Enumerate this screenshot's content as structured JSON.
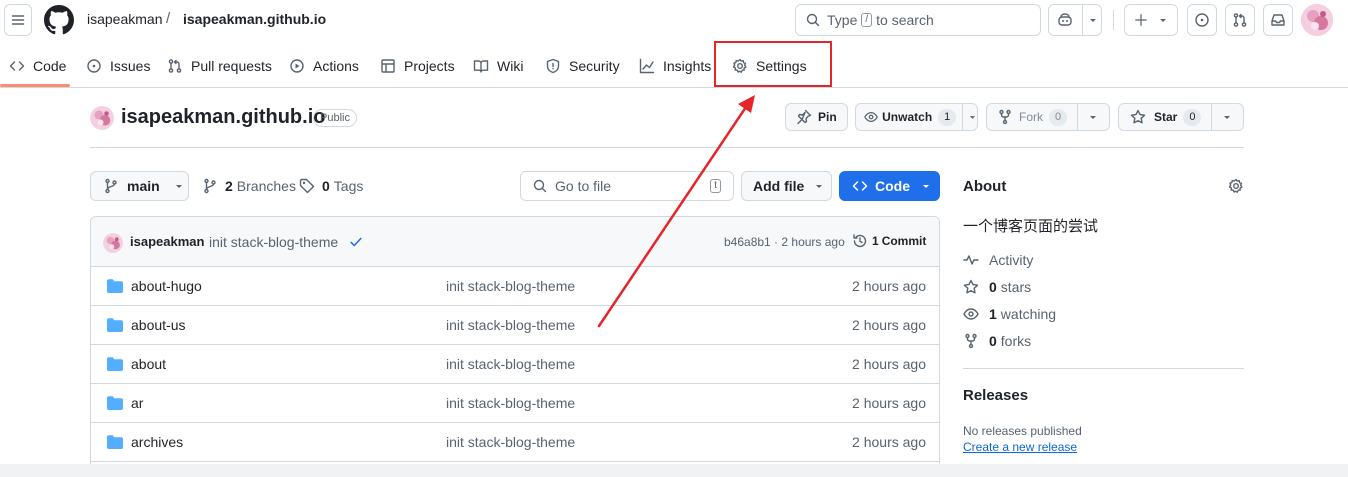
{
  "header": {
    "owner": "isapeakman",
    "separator": "/",
    "repo": "isapeakman.github.io",
    "search_prefix": "Type",
    "search_key": "/",
    "search_suffix": "to search"
  },
  "tabs": [
    {
      "label": "Code",
      "icon": "code-icon"
    },
    {
      "label": "Issues",
      "icon": "issue-icon"
    },
    {
      "label": "Pull requests",
      "icon": "pull-request-icon"
    },
    {
      "label": "Actions",
      "icon": "play-icon"
    },
    {
      "label": "Projects",
      "icon": "table-icon"
    },
    {
      "label": "Wiki",
      "icon": "book-icon"
    },
    {
      "label": "Security",
      "icon": "shield-icon"
    },
    {
      "label": "Insights",
      "icon": "graph-icon"
    },
    {
      "label": "Settings",
      "icon": "gear-icon"
    }
  ],
  "repo": {
    "title": "isapeakman.github.io",
    "visibility": "Public",
    "pin_label": "Pin",
    "watch_label": "Unwatch",
    "watch_count": "1",
    "fork_label": "Fork",
    "fork_count": "0",
    "star_label": "Star",
    "star_count": "0"
  },
  "controls": {
    "branch": "main",
    "branches_count": "2",
    "branches_label": "Branches",
    "tags_count": "0",
    "tags_label": "Tags",
    "goto_placeholder": "Go to file",
    "goto_key": "t",
    "add_file": "Add file",
    "code": "Code"
  },
  "commit": {
    "author": "isapeakman",
    "message": "init stack-blog-theme",
    "hash_time": "b46a8b1 · 2 hours ago",
    "commits_count": "1",
    "commits_label": "Commit"
  },
  "files": [
    {
      "name": "about-hugo",
      "message": "init stack-blog-theme",
      "age": "2 hours ago"
    },
    {
      "name": "about-us",
      "message": "init stack-blog-theme",
      "age": "2 hours ago"
    },
    {
      "name": "about",
      "message": "init stack-blog-theme",
      "age": "2 hours ago"
    },
    {
      "name": "ar",
      "message": "init stack-blog-theme",
      "age": "2 hours ago"
    },
    {
      "name": "archives",
      "message": "init stack-blog-theme",
      "age": "2 hours ago"
    }
  ],
  "about": {
    "heading": "About",
    "description": "一个博客页面的尝试",
    "activity": "Activity",
    "stars_count": "0",
    "stars_label": "stars",
    "watching_count": "1",
    "watching_label": "watching",
    "forks_count": "0",
    "forks_label": "forks"
  },
  "releases": {
    "heading": "Releases",
    "none": "No releases published",
    "create_link": "Create a new release"
  },
  "colors": {
    "accent": "#1f6feb",
    "annotation": "#e5252a",
    "folder": "#54aeff",
    "active_tab": "#fd8c73"
  }
}
